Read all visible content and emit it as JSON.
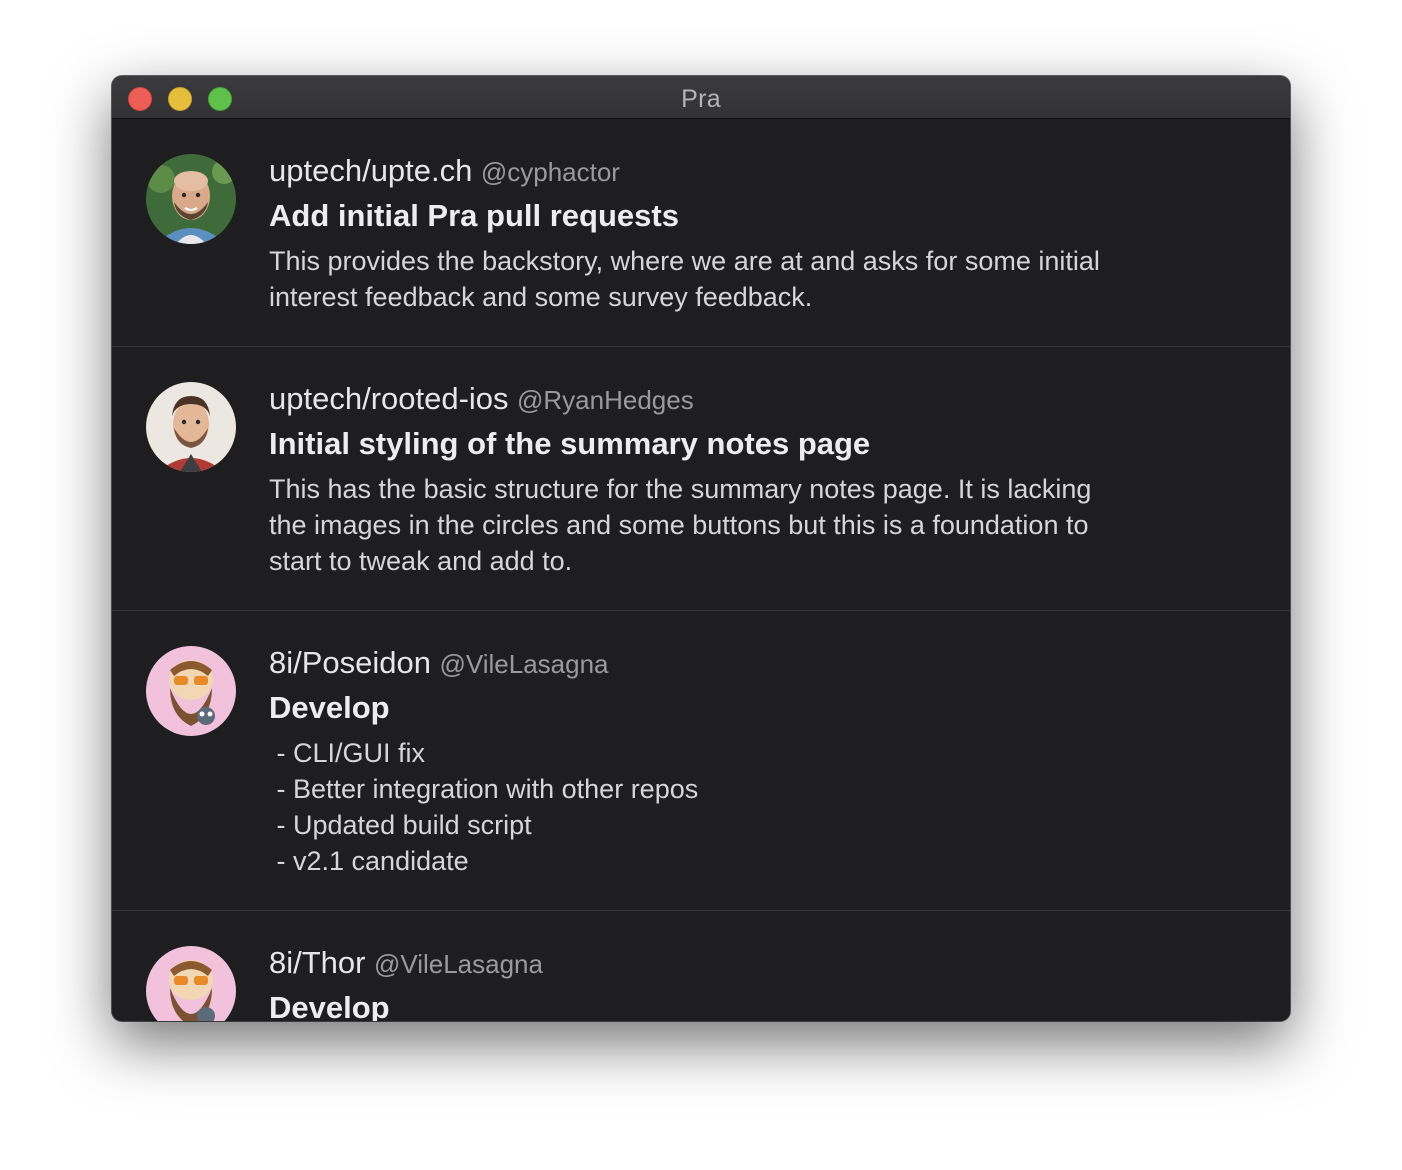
{
  "window": {
    "title": "Pra"
  },
  "pull_requests": [
    {
      "repo": "uptech/upte.ch",
      "author": "@cyphactor",
      "title": "Add initial Pra pull requests",
      "body": "This provides the backstory, where we are at and asks for some initial\ninterest feedback and some survey feedback."
    },
    {
      "repo": "uptech/rooted-ios",
      "author": "@RyanHedges",
      "title": "Initial styling of the summary notes page",
      "body": "This has the basic structure for the summary notes page. It is lacking\nthe images in the circles and some buttons but this is a foundation to\nstart to tweak and add to."
    },
    {
      "repo": "8i/Poseidon",
      "author": "@VileLasagna",
      "title": "Develop",
      "body": " - CLI/GUI fix\n - Better integration with other repos\n - Updated build script\n - v2.1 candidate"
    },
    {
      "repo": "8i/Thor",
      "author": "@VileLasagna",
      "title": "Develop",
      "body": ""
    }
  ]
}
